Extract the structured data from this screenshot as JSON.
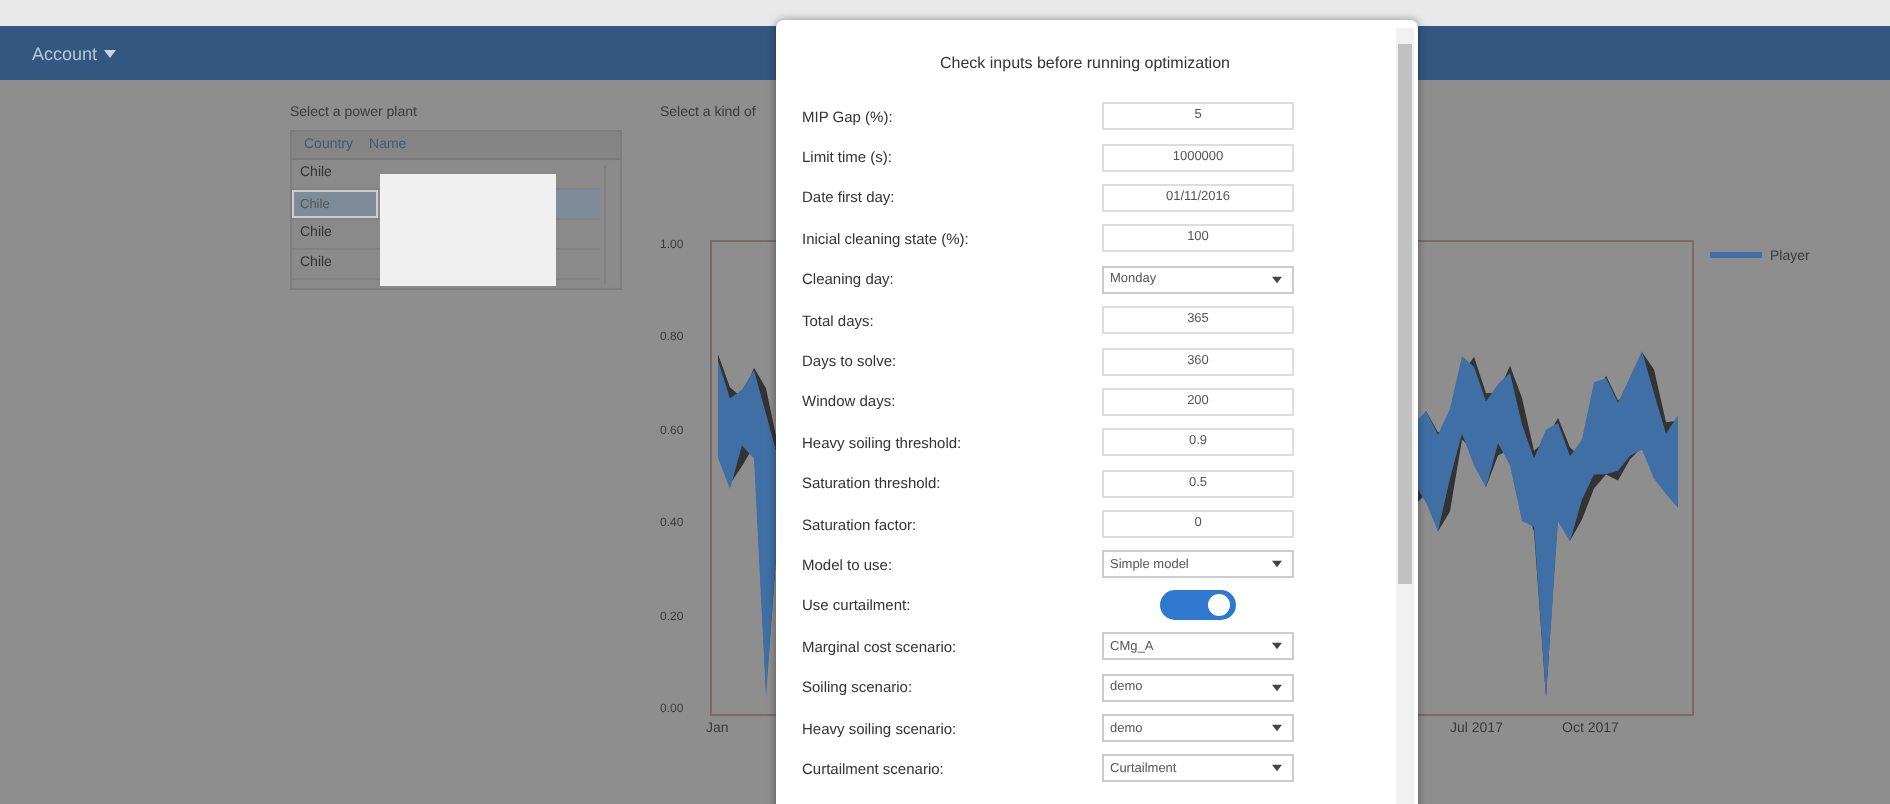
{
  "navbar": {
    "account": "Account"
  },
  "plant_picker": {
    "label": "Select a power plant",
    "columns": [
      "Country",
      "Name"
    ],
    "rows": [
      {
        "country": "Chile",
        "selected": false
      },
      {
        "country": "Chile",
        "selected": true
      },
      {
        "country": "Chile",
        "selected": false
      },
      {
        "country": "Chile",
        "selected": false
      }
    ]
  },
  "chart_panel": {
    "label": "Select a kind of",
    "yticks": [
      "1.00",
      "0.80",
      "0.60",
      "0.40",
      "0.20",
      "0.00"
    ],
    "xticks": [
      "Jan",
      "Jul 2017",
      "Oct 2017"
    ],
    "legend": "Player"
  },
  "dialog": {
    "title": "Check inputs before running optimization",
    "fields": [
      {
        "label": "MIP Gap (%):",
        "kind": "input",
        "value": "5"
      },
      {
        "label": "Limit time (s):",
        "kind": "input",
        "value": "1000000"
      },
      {
        "label": "Date first day:",
        "kind": "input",
        "value": "01/11/2016"
      },
      {
        "label": "Inicial cleaning state (%):",
        "kind": "input",
        "value": "100"
      },
      {
        "label": "Cleaning day:",
        "kind": "select",
        "value": "Monday"
      },
      {
        "label": "Total days:",
        "kind": "input",
        "value": "365"
      },
      {
        "label": "Days to solve:",
        "kind": "input",
        "value": "360"
      },
      {
        "label": "Window days:",
        "kind": "input",
        "value": "200"
      },
      {
        "label": "Heavy soiling threshold:",
        "kind": "input",
        "value": "0.9"
      },
      {
        "label": "Saturation threshold:",
        "kind": "input",
        "value": "0.5"
      },
      {
        "label": "Saturation factor:",
        "kind": "input",
        "value": "0"
      },
      {
        "label": "Model to use:",
        "kind": "select",
        "value": "Simple model"
      },
      {
        "label": "Use curtailment:",
        "kind": "toggle",
        "on": true
      },
      {
        "label": "Marginal cost scenario:",
        "kind": "select",
        "value": "CMg_A"
      },
      {
        "label": "Soiling scenario:",
        "kind": "select",
        "value": "demo"
      },
      {
        "label": "Heavy soiling scenario:",
        "kind": "select",
        "value": "demo"
      },
      {
        "label": "Curtailment scenario:",
        "kind": "select",
        "value": "Curtailment"
      }
    ]
  }
}
